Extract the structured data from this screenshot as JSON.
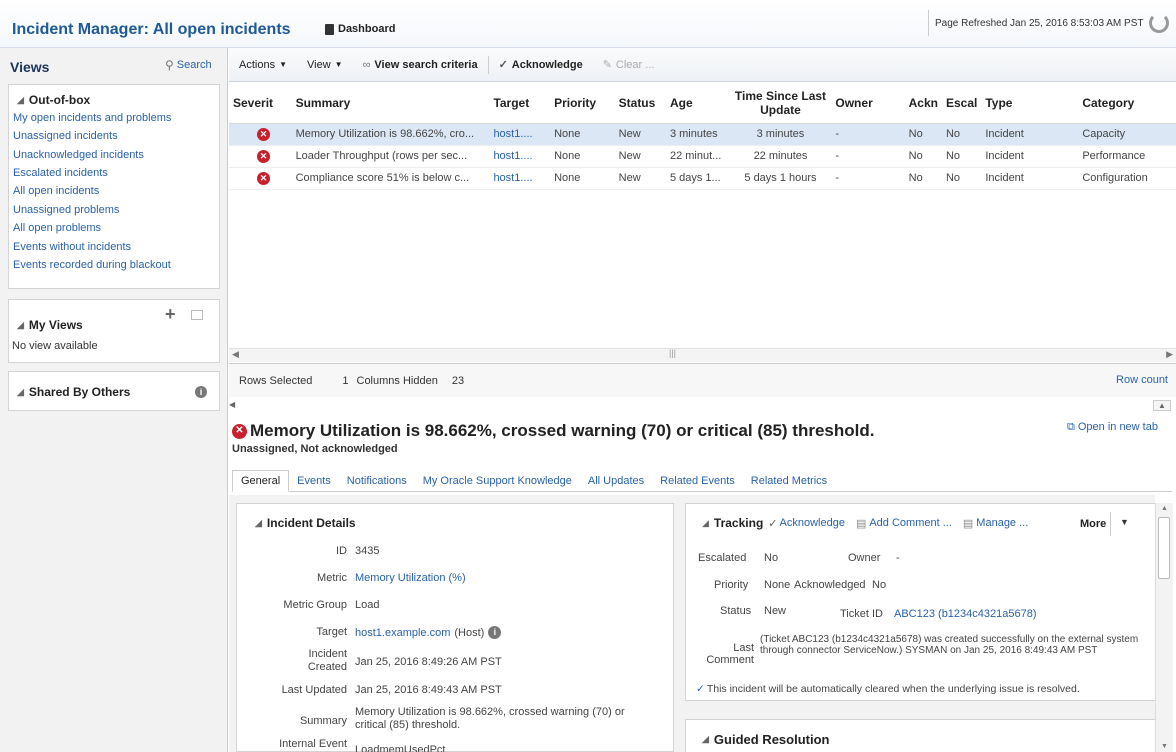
{
  "header": {
    "title": "Incident Manager: All open incidents",
    "dashboard": "Dashboard",
    "refreshed": "Page Refreshed Jan 25, 2016 8:53:03 AM PST"
  },
  "sidebar": {
    "title": "Views",
    "search": "Search",
    "outofbox": {
      "title": "Out-of-box",
      "items": [
        "My open incidents and problems",
        "Unassigned incidents",
        "Unacknowledged incidents",
        "Escalated incidents",
        "All open incidents",
        "Unassigned problems",
        "All open problems",
        "Events without incidents",
        "Events recorded during blackout"
      ]
    },
    "myviews": {
      "title": "My Views",
      "empty": "No view available"
    },
    "shared": {
      "title": "Shared By Others"
    }
  },
  "toolbar": {
    "actions": "Actions",
    "view": "View",
    "search_criteria": "View search criteria",
    "acknowledge": "Acknowledge",
    "clear": "Clear ..."
  },
  "grid": {
    "columns": [
      "Severit",
      "Summary",
      "Target",
      "Priority",
      "Status",
      "Age",
      "Time Since Last Update",
      "Owner",
      "Ackn",
      "Escal",
      "Type",
      "Category"
    ],
    "rows": [
      [
        "Memory Utilization is 98.662%, cro...",
        "host1....",
        "None",
        "New",
        "3 minutes",
        "3 minutes",
        "-",
        "No",
        "No",
        "Incident",
        "Capacity"
      ],
      [
        "Loader Throughput (rows per sec...",
        "host1....",
        "None",
        "New",
        "22 minut...",
        "22 minutes",
        "-",
        "No",
        "No",
        "Incident",
        "Performance"
      ],
      [
        "Compliance score 51% is below c...",
        "host1....",
        "None",
        "New",
        "5 days 1...",
        "5 days 1 hours",
        "-",
        "No",
        "No",
        "Incident",
        "Configuration"
      ]
    ]
  },
  "statusbar": {
    "rows_selected_label": "Rows Selected",
    "rows_selected": "1",
    "columns_hidden_label": "Columns Hidden",
    "columns_hidden": "23",
    "row_count": "Row count"
  },
  "detail": {
    "title": "Memory Utilization is 98.662%, crossed warning (70) or critical (85) threshold.",
    "subtitle": "Unassigned, Not acknowledged",
    "open_new_tab": "Open in new tab",
    "tabs": [
      "General",
      "Events",
      "Notifications",
      "My Oracle Support Knowledge",
      "All Updates",
      "Related Events",
      "Related Metrics"
    ]
  },
  "incident": {
    "title": "Incident Details",
    "id_label": "ID",
    "id": "3435",
    "metric_label": "Metric",
    "metric": "Memory Utilization (%)",
    "metric_group_label": "Metric Group",
    "metric_group": "Load",
    "target_label": "Target",
    "target": "host1.example.com",
    "target_type": "(Host)",
    "created_label": "Incident Created",
    "created": "Jan 25, 2016 8:49:26 AM PST",
    "updated_label": "Last Updated",
    "updated": "Jan 25, 2016 8:49:43 AM PST",
    "summary_label": "Summary",
    "summary": "Memory Utilization is 98.662%, crossed warning (70) or critical (85) threshold.",
    "internal_label": "Internal Event",
    "internal": "LoadmemUsedPct"
  },
  "tracking": {
    "title": "Tracking",
    "acknowledge": "Acknowledge",
    "add_comment": "Add Comment ...",
    "manage": "Manage ...",
    "more": "More",
    "escalated_label": "Escalated",
    "escalated": "No",
    "owner_label": "Owner",
    "owner": "-",
    "priority_label": "Priority",
    "priority": "None",
    "ack_label": "Acknowledged",
    "ack": "No",
    "status_label": "Status",
    "status": "New",
    "ticket_label": "Ticket ID",
    "ticket": "ABC123 (b1234c4321a5678)",
    "comment_label": "Last Comment",
    "comment": "(Ticket ABC123 (b1234c4321a5678) was created successfully on the external system through connector ServiceNow.) SYSMAN on Jan 25, 2016 8:49:43 AM PST",
    "auto_clear": "This incident will be automatically cleared when the underlying issue is resolved."
  },
  "guided": {
    "title": "Guided Resolution"
  }
}
